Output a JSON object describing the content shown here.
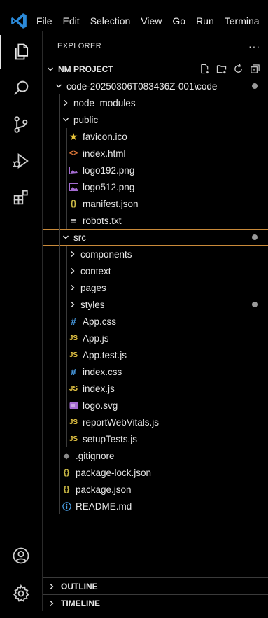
{
  "menu": [
    "File",
    "Edit",
    "Selection",
    "View",
    "Go",
    "Run",
    "Termina"
  ],
  "colors": {
    "background": "#000000",
    "vscode_blue": "#2b8ad9",
    "selected_outline": "#c98a3a",
    "js_yellow": "#e5c544",
    "css_blue": "#4a9fe8",
    "html_orange": "#e57b3a",
    "json_yellow": "#d9c64a",
    "image_purple": "#a56cd3",
    "modified_dot": "#9a9a9a"
  },
  "sidebar": {
    "title": "EXPLORER",
    "more": "···",
    "root": "NM PROJECT",
    "root_actions": [
      "new-file-icon",
      "new-folder-icon",
      "refresh-icon",
      "collapse-all-icon"
    ],
    "items": [
      {
        "label": "code-20250306T083436Z-001\\code",
        "depth": 1,
        "kind": "folder",
        "open": true,
        "modified": true
      },
      {
        "label": "node_modules",
        "depth": 2,
        "kind": "folder",
        "open": false
      },
      {
        "label": "public",
        "depth": 2,
        "kind": "folder",
        "open": true
      },
      {
        "label": "favicon.ico",
        "depth": 3,
        "kind": "favicon"
      },
      {
        "label": "index.html",
        "depth": 3,
        "kind": "html"
      },
      {
        "label": "logo192.png",
        "depth": 3,
        "kind": "image"
      },
      {
        "label": "logo512.png",
        "depth": 3,
        "kind": "image"
      },
      {
        "label": "manifest.json",
        "depth": 3,
        "kind": "json"
      },
      {
        "label": "robots.txt",
        "depth": 3,
        "kind": "text"
      },
      {
        "label": "src",
        "depth": 2,
        "kind": "folder",
        "open": true,
        "modified": true,
        "selected": true
      },
      {
        "label": "components",
        "depth": 3,
        "kind": "folder",
        "open": false
      },
      {
        "label": "context",
        "depth": 3,
        "kind": "folder",
        "open": false
      },
      {
        "label": "pages",
        "depth": 3,
        "kind": "folder",
        "open": false
      },
      {
        "label": "styles",
        "depth": 3,
        "kind": "folder",
        "open": false,
        "modified": true
      },
      {
        "label": "App.css",
        "depth": 3,
        "kind": "css"
      },
      {
        "label": "App.js",
        "depth": 3,
        "kind": "js"
      },
      {
        "label": "App.test.js",
        "depth": 3,
        "kind": "js"
      },
      {
        "label": "index.css",
        "depth": 3,
        "kind": "css"
      },
      {
        "label": "index.js",
        "depth": 3,
        "kind": "js"
      },
      {
        "label": "logo.svg",
        "depth": 3,
        "kind": "svg"
      },
      {
        "label": "reportWebVitals.js",
        "depth": 3,
        "kind": "js"
      },
      {
        "label": "setupTests.js",
        "depth": 3,
        "kind": "js"
      },
      {
        "label": ".gitignore",
        "depth": 2,
        "kind": "git"
      },
      {
        "label": "package-lock.json",
        "depth": 2,
        "kind": "json"
      },
      {
        "label": "package.json",
        "depth": 2,
        "kind": "json"
      },
      {
        "label": "README.md",
        "depth": 2,
        "kind": "info"
      }
    ]
  },
  "panels": {
    "outline": "OUTLINE",
    "timeline": "TIMELINE"
  },
  "activity": [
    "explorer-icon",
    "search-icon",
    "source-control-icon",
    "run-debug-icon",
    "extensions-icon",
    "account-icon",
    "settings-gear-icon"
  ]
}
